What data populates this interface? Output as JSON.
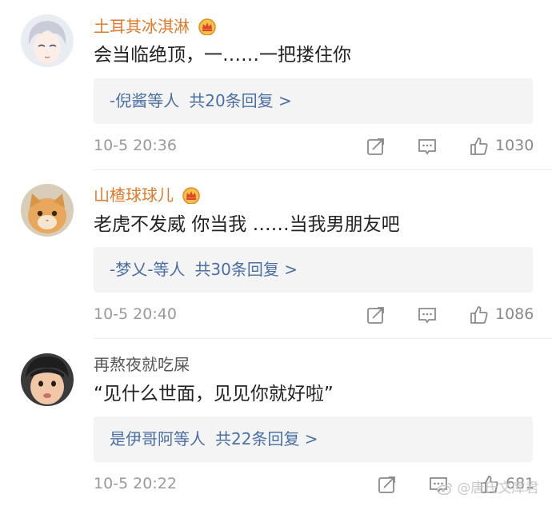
{
  "comments": [
    {
      "username": "土耳其冰淇淋",
      "content": "会当临绝顶，一……一把搂住你",
      "reply_users": "-倪酱等人",
      "reply_count": "共20条回复 >",
      "time": "10-5 20:36",
      "likes": "1030"
    },
    {
      "username": "山楂球球儿",
      "content": "老虎不发威 你当我 ……当我男朋友吧",
      "reply_users": "-梦乂-等人",
      "reply_count": "共30条回复 >",
      "time": "10-5 20:40",
      "likes": "1086"
    },
    {
      "username": "再熬夜就吃屎",
      "content": "“见什么世面，见见你就好啦”",
      "reply_users": "是伊哥阿等人",
      "reply_count": "共22条回复 >",
      "time": "10-5 20:22",
      "likes": "681"
    }
  ],
  "watermark": "@唐氏文库君",
  "colors": {
    "vip_name": "#e07a2c",
    "reply_link": "#4a6fa5",
    "meta_gray": "#9a9a9a",
    "reply_bg": "#f4f4f4"
  },
  "icons": [
    "vip-crown-icon",
    "repost-icon",
    "comment-icon",
    "like-icon",
    "weibo-logo-icon"
  ]
}
